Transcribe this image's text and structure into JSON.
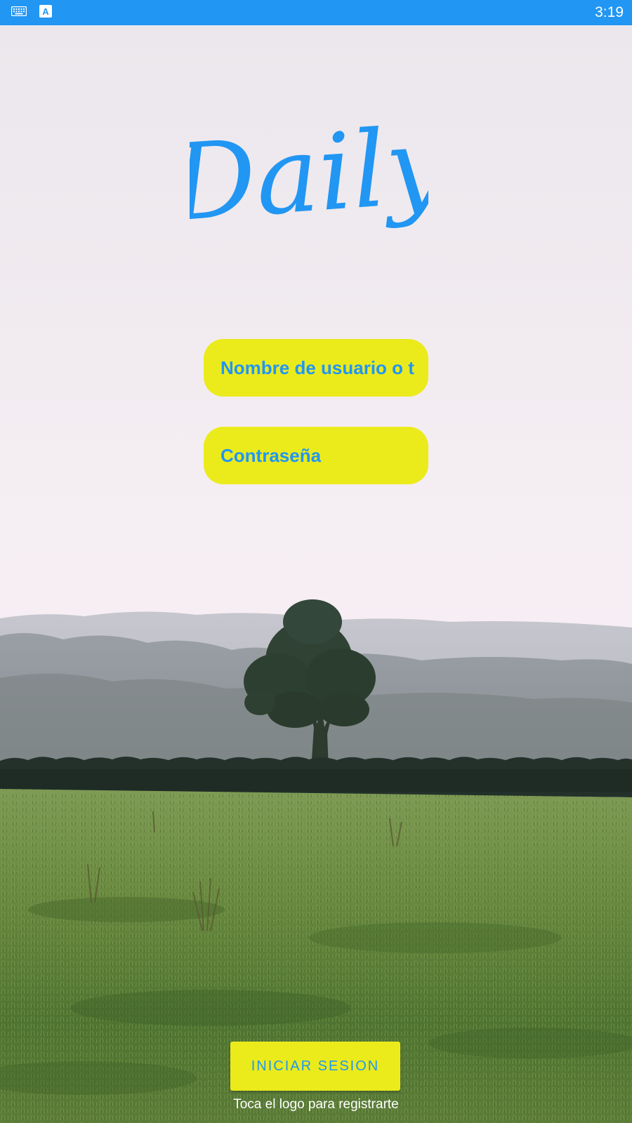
{
  "status_bar": {
    "time": "3:19",
    "icons": [
      "keyboard-icon",
      "accessibility-a-icon"
    ],
    "app_badge_letter": "A",
    "color": "#2196f3"
  },
  "logo": {
    "text": "Daily",
    "color": "#2196f3"
  },
  "form": {
    "username_placeholder": "Nombre de usuario o teléfono",
    "password_placeholder": "Contraseña",
    "field_color": "#ebeb1c",
    "text_color": "#2196f3"
  },
  "actions": {
    "login_label": "INICIAR SESION",
    "register_hint": "Toca el logo para registrarte"
  },
  "background": {
    "description_icon": "landscape-tree-field-image"
  }
}
